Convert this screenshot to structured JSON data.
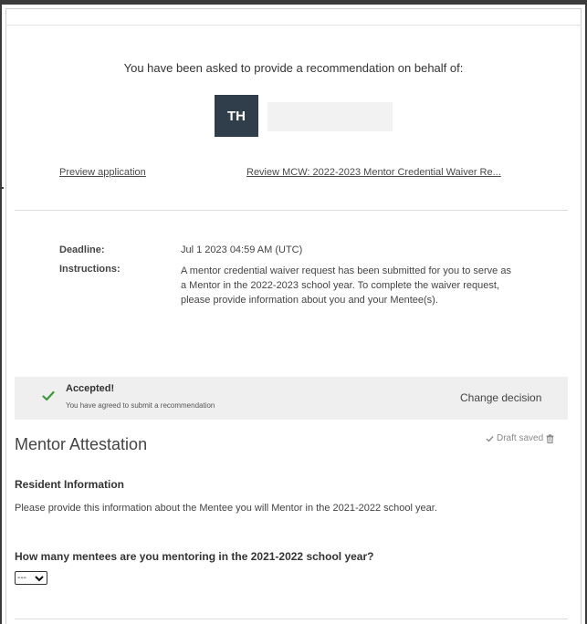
{
  "header": {
    "prompt": "You have been asked to provide a recommendation on behalf of:",
    "avatar_initials": "TH"
  },
  "links": {
    "preview": "Preview application",
    "review": "Review MCW: 2022-2023 Mentor Credential Waiver Re..."
  },
  "details": {
    "deadline_label": "Deadline:",
    "deadline_value": "Jul 1 2023 04:59 AM (UTC)",
    "instructions_label": "Instructions:",
    "instructions_value": "A mentor credential waiver request has been submitted for you to serve as a Mentor in the 2022-2023 school year. To complete the waiver request, please provide information about you and your Mentee(s)."
  },
  "status": {
    "title": "Accepted!",
    "subtitle": "You have agreed to submit a recommendation",
    "change_label": "Change decision",
    "icon": "check-icon",
    "icon_color": "#3a9a3a"
  },
  "form": {
    "title": "Mentor Attestation",
    "draft_status": "Draft saved",
    "section_heading": "Resident Information",
    "section_text": "Please provide this information about the Mentee you will Mentor in the 2021-2022 school year.",
    "question": "How many mentees are you mentoring in the 2021-2022 school year?",
    "select_value": "---"
  }
}
